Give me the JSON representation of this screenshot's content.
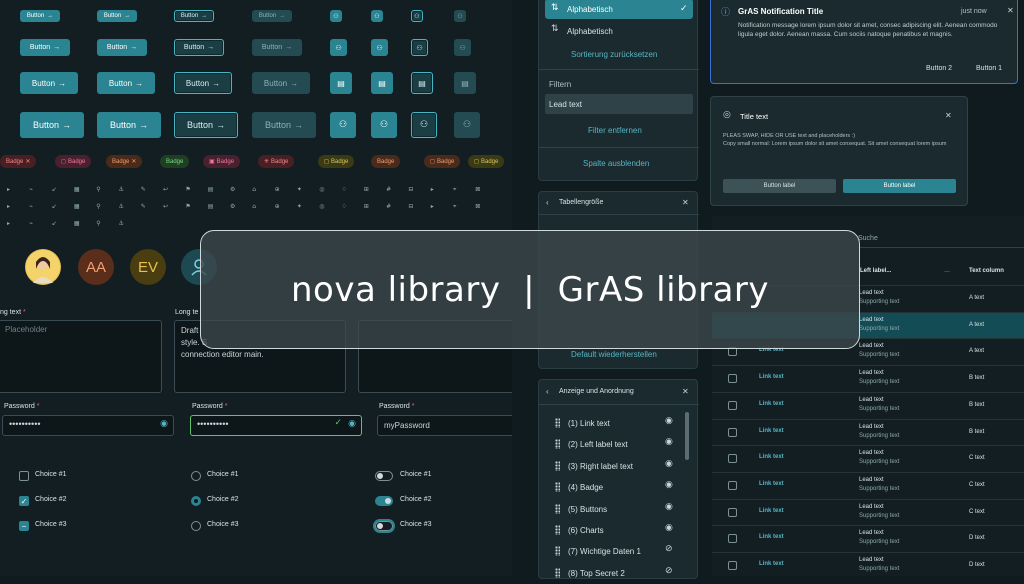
{
  "buttons": {
    "label": "Button",
    "arrow": "→"
  },
  "badges": [
    {
      "label": "Badge",
      "icon": "✕",
      "bg": "#4a1f24",
      "fg": "#f08a8a"
    },
    {
      "label": "Badge",
      "icon": "◻",
      "bg": "#4a1f2e",
      "fg": "#f07aa0"
    },
    {
      "label": "Badge",
      "icon": "✕",
      "bg": "#4a2a1a",
      "fg": "#f0a070"
    },
    {
      "label": "Badge",
      "icon": "",
      "bg": "#1f3f22",
      "fg": "#7ed88a"
    },
    {
      "label": "Badge",
      "icon": "▣",
      "bg": "#4a1f2e",
      "fg": "#f07aa0"
    },
    {
      "label": "Badge",
      "icon": "✳",
      "bg": "#4a1f24",
      "fg": "#f08a8a"
    },
    {
      "label": "Badge",
      "icon": "◻",
      "bg": "#3a3a14",
      "fg": "#d8c860"
    },
    {
      "label": "Badge",
      "icon": "",
      "bg": "#4a2a1a",
      "fg": "#f0a070"
    },
    {
      "label": "Badge",
      "icon": "◻",
      "bg": "#4a2a1a",
      "fg": "#f0a070"
    },
    {
      "label": "Badge",
      "icon": "◻",
      "bg": "#3a3a14",
      "fg": "#d8c860"
    }
  ],
  "icon_glyphs": [
    "▸",
    "⌁",
    "↙",
    "▦",
    "⚲",
    "⚓",
    "✎",
    "↩",
    "⚑",
    "▤",
    "⚙",
    "⌂",
    "⊕",
    "✦",
    "◎",
    "♢",
    "⊞",
    "#",
    "⊟",
    "▸",
    "⌖",
    "⊠"
  ],
  "avatars": [
    {
      "type": "photo"
    },
    {
      "initials": "AA",
      "bg": "#5a2e1a",
      "fg": "#f0a070"
    },
    {
      "initials": "EV",
      "bg": "#4a3d10",
      "fg": "#e8c050"
    },
    {
      "type": "user-icon",
      "bg": "#1d4a52"
    }
  ],
  "long_text": {
    "label": "ng text",
    "label2": "Long te",
    "required": "*",
    "placeholder": "Placeholder",
    "draft_lines": [
      "Draft",
      "style. S",
      "connection editor main."
    ]
  },
  "password": {
    "label": "Password",
    "required": "*",
    "masked": "••••••••••",
    "plain_value": "myPassword",
    "valid_icon": "✓",
    "eye_icon": "◉"
  },
  "choices": [
    "Choice #1",
    "Choice #2",
    "Choice #3"
  ],
  "sort_panel": {
    "selected_option": "Alphabetisch",
    "option": "Alphabetisch",
    "reset": "Sortierung zurücksetzen",
    "filter_heading": "Filtern",
    "filter_value": "Lead text",
    "remove_filter": "Filter entfernen",
    "hide_column": "Spalte ausblenden"
  },
  "table_size_panel": {
    "title": "Tabellengröße",
    "restore": "Default wiederherstellen"
  },
  "display_panel": {
    "title": "Anzeige und Anordnung",
    "items": [
      "(1) Link text",
      "(2) Left label text",
      "(3) Right label text",
      "(4) Badge",
      "(5) Buttons",
      "(6) Charts",
      "(7) Wichtige Daten 1",
      "(8) Top Secret 2"
    ],
    "hidden": [
      false,
      false,
      false,
      false,
      false,
      false,
      true,
      true
    ]
  },
  "notification": {
    "title": "GrAS Notification Title",
    "time": "just now",
    "body": "Notification message lorem ipsum dolor sit amet, consec adipiscing elit. Aenean commodo ligula eget dolor. Aenean massa. Cum sociis natoque penatibus et magnis.",
    "button2": "Button 2",
    "button1": "Button 1"
  },
  "title_card": {
    "title": "Title text",
    "line1": "PLEAS SWAP, HIDE OR USE text and placeholders :)",
    "line2": "Copy small normal: Lorem ipsum dolor sit amet consequat. Sit amet consequat lorem ipsum",
    "btn_secondary": "Button label",
    "btn_primary": "Button label"
  },
  "table": {
    "search_placeholder": "Suche",
    "headers": [
      "Left label...",
      "…",
      "Text column"
    ],
    "rows": [
      {
        "link": "",
        "lead": "Lead text",
        "sup": "Supporting text",
        "text": "A text"
      },
      {
        "link": "",
        "lead": "Lead text",
        "sup": "Supporting text",
        "text": "A text"
      },
      {
        "link": "Link text",
        "lead": "Lead text",
        "sup": "Supporting text",
        "text": "A text"
      },
      {
        "link": "Link text",
        "lead": "Lead text",
        "sup": "Supporting text",
        "text": "B text"
      },
      {
        "link": "Link text",
        "lead": "Lead text",
        "sup": "Supporting text",
        "text": "B text"
      },
      {
        "link": "Link text",
        "lead": "Lead text",
        "sup": "Supporting text",
        "text": "B text"
      },
      {
        "link": "Link text",
        "lead": "Lead text",
        "sup": "Supporting text",
        "text": "C text"
      },
      {
        "link": "Link text",
        "lead": "Lead text",
        "sup": "Supporting text",
        "text": "C text"
      },
      {
        "link": "Link text",
        "lead": "Lead text",
        "sup": "Supporting text",
        "text": "C text"
      },
      {
        "link": "Link text",
        "lead": "Lead text",
        "sup": "Supporting text",
        "text": "D text"
      },
      {
        "link": "Link text",
        "lead": "Lead text",
        "sup": "Supporting text",
        "text": "D text"
      }
    ]
  },
  "overlay": {
    "title": "nova library  |  GrAS library"
  },
  "colors": {
    "accent": "#2b8491",
    "link": "#56b6c4",
    "background": "#0f1b1f"
  }
}
